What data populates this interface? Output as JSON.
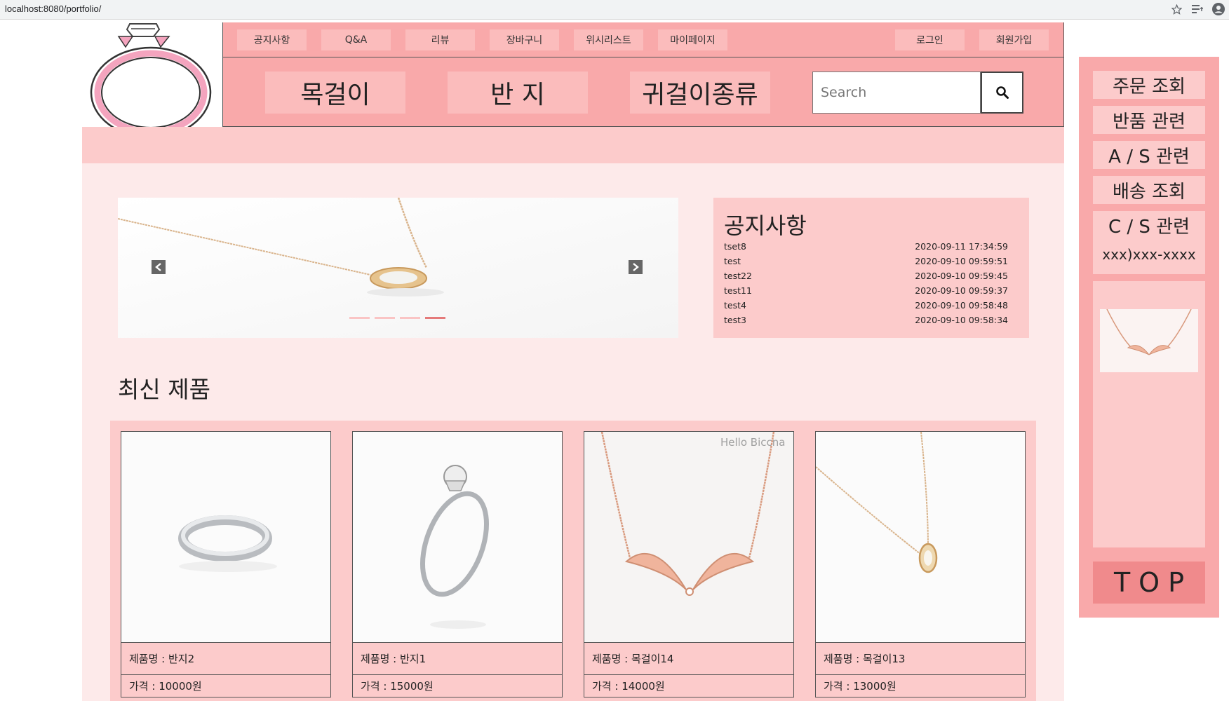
{
  "browser": {
    "url": "localhost:8080/portfolio/"
  },
  "topnav": {
    "items": [
      "공지사항",
      "Q&A",
      "리뷰",
      "장바구니",
      "위시리스트",
      "마이페이지"
    ],
    "login": "로그인",
    "signup": "회원가입"
  },
  "categories": [
    "목걸이",
    "반 지",
    "귀걸이종류"
  ],
  "search": {
    "placeholder": "Search"
  },
  "notice": {
    "title": "공지사항",
    "rows": [
      {
        "title": "tset8",
        "date": "2020-09-11 17:34:59"
      },
      {
        "title": "test",
        "date": "2020-09-10 09:59:51"
      },
      {
        "title": "test22",
        "date": "2020-09-10 09:59:45"
      },
      {
        "title": "test11",
        "date": "2020-09-10 09:59:37"
      },
      {
        "title": "test4",
        "date": "2020-09-10 09:58:48"
      },
      {
        "title": "test3",
        "date": "2020-09-10 09:58:34"
      }
    ]
  },
  "slider": {
    "active_index": 3,
    "slide_count": 4
  },
  "latest": {
    "title": "최신 제품",
    "products": [
      {
        "name": "제품명 : 반지2",
        "price": "가격 : 10000원"
      },
      {
        "name": "제품명 : 반지1",
        "price": "가격 : 15000원"
      },
      {
        "name": "제품명 : 목걸이14",
        "price": "가격 : 14000원"
      },
      {
        "name": "제품명 : 목걸이13",
        "price": "가격 : 13000원"
      }
    ],
    "watermark": "Hello Biccna"
  },
  "sidebar": {
    "buttons": [
      "주문 조회",
      "반품 관련",
      "A / S 관련",
      "배송 조회",
      "C / S 관련"
    ],
    "phone": "xxx)xxx-xxxx",
    "top": "TOP"
  },
  "colors": {
    "pink_dark": "#f9a9aa",
    "pink_mid": "#fccbcb",
    "pink_light": "#fdeaea",
    "top_button": "#f08a8c"
  }
}
